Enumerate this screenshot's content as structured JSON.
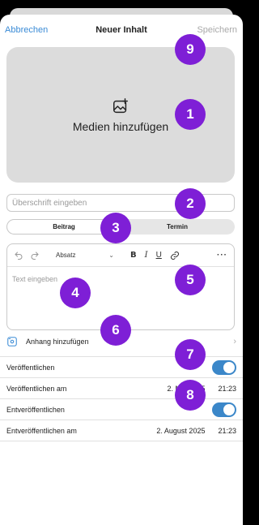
{
  "nav": {
    "cancel": "Abbrechen",
    "title": "Neuer Inhalt",
    "save": "Speichern"
  },
  "media": {
    "label": "Medien hinzufügen",
    "icon": "add-image-icon"
  },
  "title_input": {
    "placeholder": "Überschrift eingeben"
  },
  "segment": {
    "options": [
      "Beitrag",
      "Termin"
    ],
    "selected": "Beitrag"
  },
  "editor": {
    "format": "Absatz",
    "toolbar": [
      "undo-icon",
      "redo-icon",
      "B",
      "I",
      "U",
      "link-icon",
      "···"
    ],
    "placeholder": "Text eingeben"
  },
  "attachment": {
    "label": "Anhang hinzufügen",
    "icon": "attachment-icon"
  },
  "publish": {
    "label": "Veröffentlichen",
    "enabled": true
  },
  "publish_at": {
    "label": "Veröffentlichen am",
    "date": "2. Mai 2025",
    "time": "21:23"
  },
  "unpublish": {
    "label": "Entveröffentlichen",
    "enabled": true
  },
  "unpublish_at": {
    "label": "Entveröffentlichen am",
    "date": "2. August 2025",
    "time": "21:23"
  },
  "badges": [
    "1",
    "2",
    "3",
    "4",
    "5",
    "6",
    "7",
    "8",
    "9"
  ],
  "colors": {
    "accent": "#3a8bd6",
    "toggle": "#3b87c9",
    "badge": "#7e1fd6"
  }
}
